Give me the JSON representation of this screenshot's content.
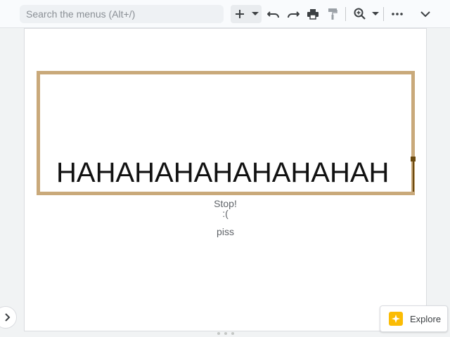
{
  "toolbar": {
    "search_placeholder": "Search the menus (Alt+/)",
    "buttons": [
      {
        "name": "insert-button",
        "icon": "plus-icon"
      },
      {
        "name": "insert-dropdown-button",
        "icon": "caret-down-icon"
      },
      {
        "name": "undo-button",
        "icon": "undo-icon"
      },
      {
        "name": "redo-button",
        "icon": "redo-icon"
      },
      {
        "name": "print-button",
        "icon": "print-icon"
      },
      {
        "name": "paint-format-button",
        "icon": "paint-roller-icon"
      },
      {
        "name": "zoom-button",
        "icon": "zoom-in-icon"
      },
      {
        "name": "zoom-dropdown-button",
        "icon": "caret-down-icon"
      },
      {
        "name": "more-button",
        "icon": "more-horizontal-icon"
      },
      {
        "name": "collapse-menus-button",
        "icon": "chevron-down-icon"
      }
    ]
  },
  "slide": {
    "main_text": "HAHAHAHAHAHAHAHAH",
    "caption_line1": "Stop!",
    "caption_line2": ":(",
    "caption_line3": "piss"
  },
  "explore": {
    "label": "Explore"
  },
  "colors": {
    "textbox_border": "#c9a97a",
    "cursor": "#6b4a10",
    "explore_icon": "#fbbc04"
  }
}
